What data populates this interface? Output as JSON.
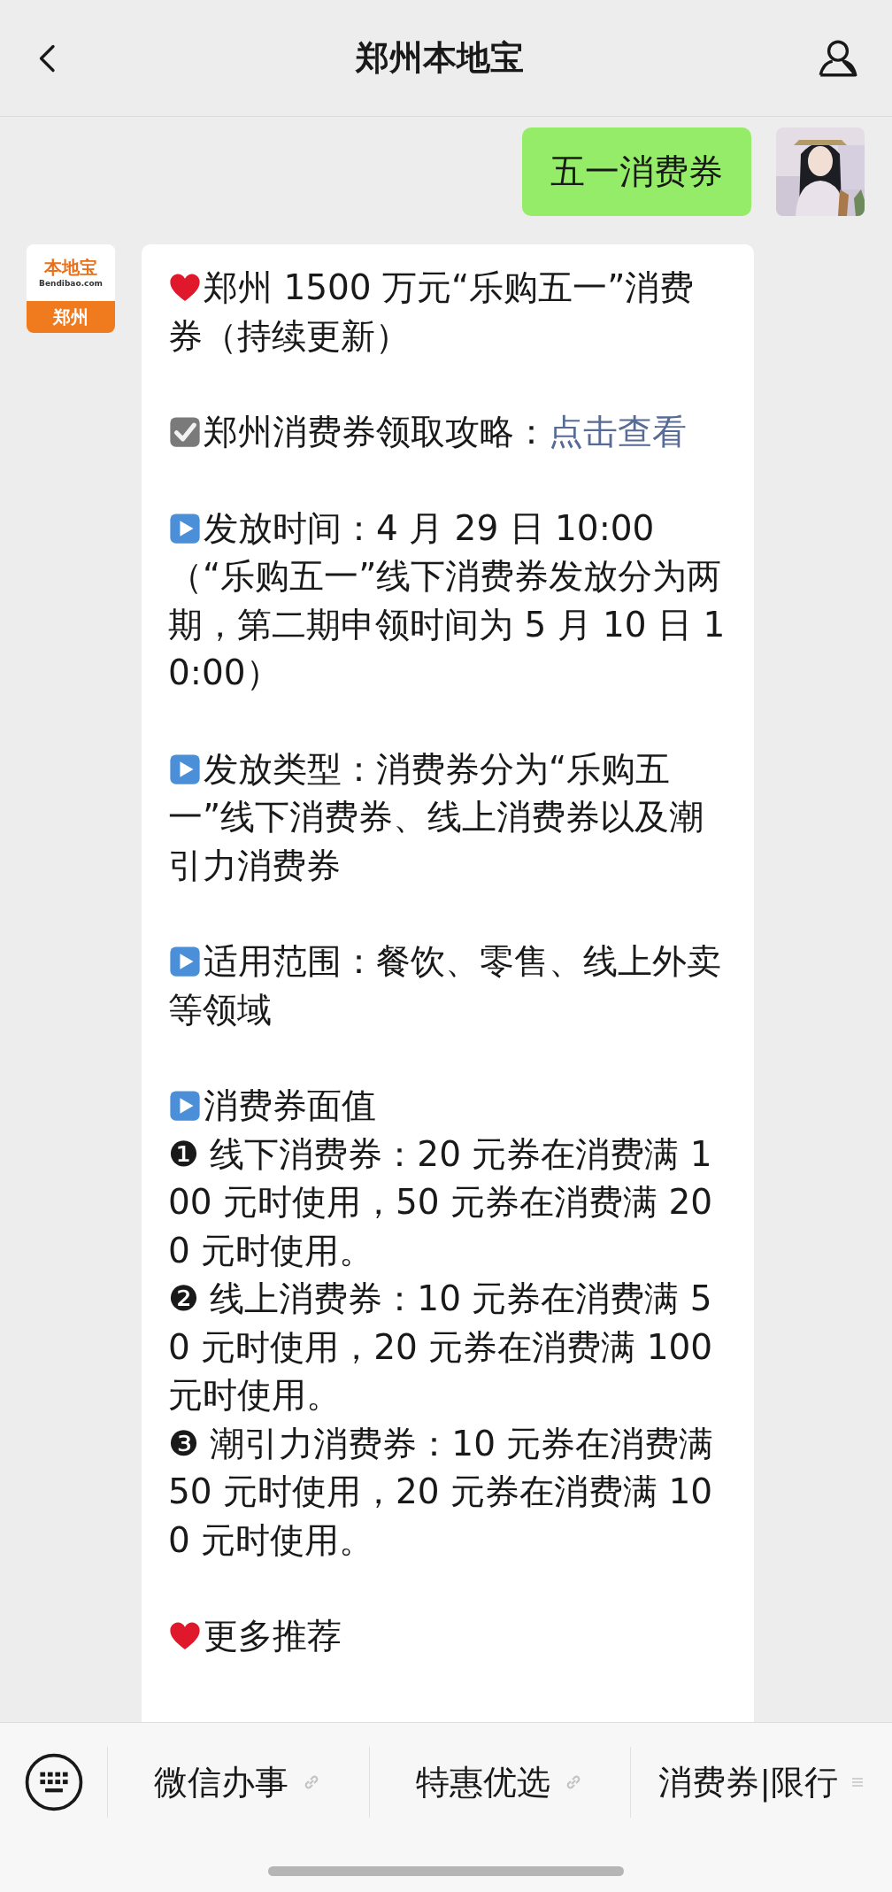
{
  "header": {
    "title": "郑州本地宝"
  },
  "messages": [
    {
      "kind": "sent",
      "text": "五一消费券"
    },
    {
      "kind": "received",
      "logo": {
        "brand": "本地宝",
        "site": "Bendibao.com",
        "city": "郑州"
      },
      "paragraphs": [
        {
          "kind": "heart",
          "lines": [
            "郑州 1500 万元“乐购五一”消费券（持续更新）"
          ]
        },
        {
          "kind": "check",
          "lines": [
            "郑州消费券领取攻略："
          ],
          "link": "点击查看"
        },
        {
          "kind": "play",
          "lines": [
            "发放时间：4 月 29 日 10:00（“乐购五一”线下消费券发放分为两期，第二期申领时间为 5 月 10 日 10:00）"
          ]
        },
        {
          "kind": "play",
          "lines": [
            "发放类型：消费券分为“乐购五一”线下消费券、线上消费券以及潮引力消费券"
          ]
        },
        {
          "kind": "play",
          "lines": [
            "适用范围：餐饮、零售、线上外卖等领域"
          ]
        },
        {
          "kind": "play",
          "lines": [
            "消费券面值",
            "❶ 线下消费券：20 元券在消费满 100 元时使用，50 元券在消费满 200 元时使用。",
            "❷ 线上消费券：10 元券在消费满 50 元时使用，20 元券在消费满 100 元时使用。",
            "❸ 潮引力消费券：10 元券在消费满50 元时使用，20 元券在消费满 100 元时使用。"
          ]
        },
        {
          "kind": "heart",
          "lines": [
            "更多推荐"
          ]
        }
      ]
    }
  ],
  "menu": [
    {
      "label": "微信办事",
      "kind": "link"
    },
    {
      "label": "特惠优选",
      "kind": "link"
    },
    {
      "label": "消费券|限行",
      "kind": "submenu"
    }
  ]
}
